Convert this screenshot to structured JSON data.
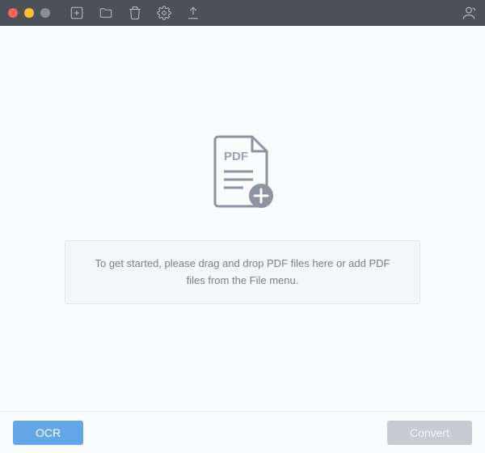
{
  "dropzone": {
    "instructions": "To get started, please drag and drop PDF files here or add PDF files from the File menu."
  },
  "footer": {
    "ocr_label": "OCR",
    "convert_label": "Convert"
  },
  "illustration": {
    "pdf_label": "PDF"
  }
}
